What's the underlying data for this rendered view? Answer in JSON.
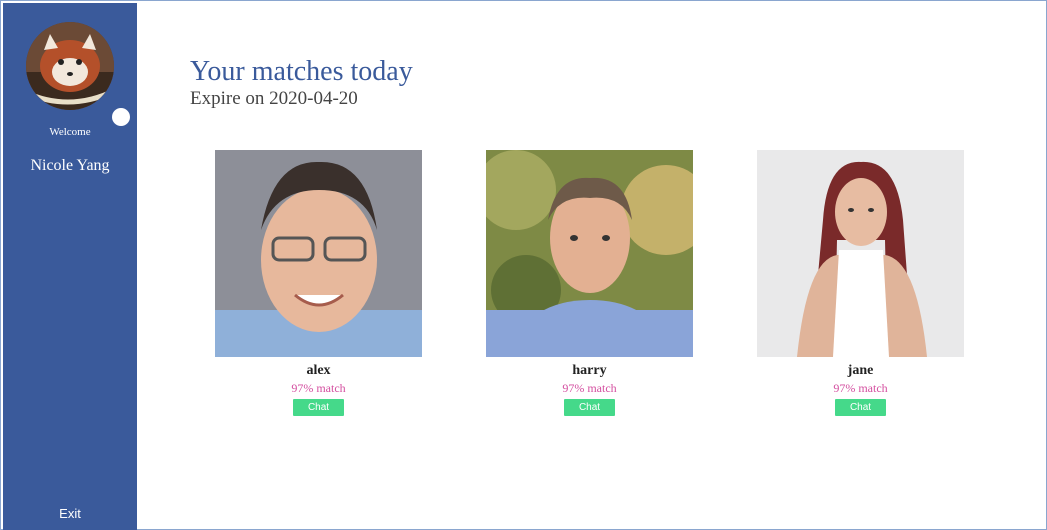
{
  "sidebar": {
    "welcome": "Welcome",
    "user_name": "Nicole Yang",
    "exit_label": "Exit",
    "avatar_icon": "red-panda-avatar",
    "bg_color": "#3a5a9b"
  },
  "main": {
    "title": "Your matches today",
    "expire_text": "Expire on 2020-04-20"
  },
  "matches": [
    {
      "name": "alex",
      "match": "97% match",
      "chat_label": "Chat"
    },
    {
      "name": "harry",
      "match": "97% match",
      "chat_label": "Chat"
    },
    {
      "name": "jane",
      "match": "97% match",
      "chat_label": "Chat"
    }
  ],
  "colors": {
    "accent": "#3a5a9b",
    "match_pink": "#d44fa0",
    "chat_green": "#45d98a"
  }
}
